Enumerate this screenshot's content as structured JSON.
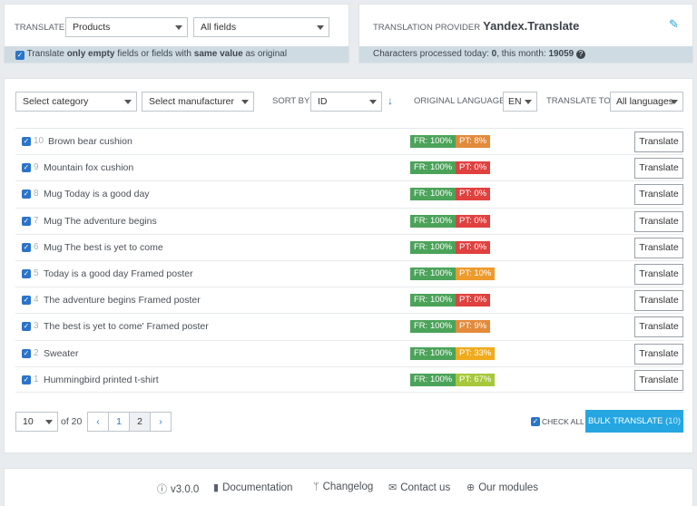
{
  "translate_bar": {
    "label": "TRANSLATE",
    "type_value": "Products",
    "fields_value": "All fields",
    "option_prefix": "Translate ",
    "option_bold1": "only empty",
    "option_mid": " fields or fields with ",
    "option_bold2": "same value",
    "option_suffix": " as original"
  },
  "provider": {
    "label": "TRANSLATION PROVIDER",
    "name": "Yandex.Translate",
    "chars_prefix": "Characters processed today: ",
    "chars_today": "0",
    "chars_mid": ", this month: ",
    "chars_month": "19059",
    "help_glyph": "?"
  },
  "filters": {
    "category": "Select category",
    "manufacturer": "Select manufacturer",
    "sort_label": "SORT BY",
    "sort_value": "ID",
    "sort_icon": "sort-desc-arrow",
    "orig_lang_label": "ORIGINAL LANGUAGE",
    "orig_lang_value": "EN",
    "translate_to_label": "TRANSLATE TO",
    "translate_to_value": "All languages"
  },
  "products": [
    {
      "id": "10",
      "name": "Brown bear cushion",
      "fr": "FR: 100%",
      "pt": "PT: 8%",
      "pt_color": "#e38a3b"
    },
    {
      "id": "9",
      "name": "Mountain fox cushion",
      "fr": "FR: 100%",
      "pt": "PT: 0%",
      "pt_color": "#e0413f"
    },
    {
      "id": "8",
      "name": "Mug Today is a good day",
      "fr": "FR: 100%",
      "pt": "PT: 0%",
      "pt_color": "#e0413f"
    },
    {
      "id": "7",
      "name": "Mug The adventure begins",
      "fr": "FR: 100%",
      "pt": "PT: 0%",
      "pt_color": "#e0413f"
    },
    {
      "id": "6",
      "name": "Mug The best is yet to come",
      "fr": "FR: 100%",
      "pt": "PT: 0%",
      "pt_color": "#e0413f"
    },
    {
      "id": "5",
      "name": "Today is a good day Framed poster",
      "fr": "FR: 100%",
      "pt": "PT: 10%",
      "pt_color": "#ee9a2c"
    },
    {
      "id": "4",
      "name": "The adventure begins Framed poster",
      "fr": "FR: 100%",
      "pt": "PT: 0%",
      "pt_color": "#e0413f"
    },
    {
      "id": "3",
      "name": "The best is yet to come' Framed poster",
      "fr": "FR: 100%",
      "pt": "PT: 9%",
      "pt_color": "#e38a3b"
    },
    {
      "id": "2",
      "name": "Sweater",
      "fr": "FR: 100%",
      "pt": "PT: 33%",
      "pt_color": "#f0ab1c"
    },
    {
      "id": "1",
      "name": "Hummingbird printed t-shirt",
      "fr": "FR: 100%",
      "pt": "PT: 67%",
      "pt_color": "#a6c83a"
    }
  ],
  "fr_color": "#4ba35a",
  "translate_label": "Translate",
  "pagination": {
    "per_page": "10",
    "of_total": "of 20",
    "prev_icon": "chevron-left",
    "pages": [
      "1",
      "2"
    ],
    "current_page": "2",
    "next_icon": "chevron-right"
  },
  "check_all_label": "CHECK ALL",
  "bulk_label": "BULK TRANSLATE",
  "bulk_count": "(10)",
  "accent_color": "#25a6e1",
  "footer": {
    "version": "v3.0.0",
    "documentation": "Documentation",
    "changelog": "Changelog",
    "contact": "Contact us",
    "modules": "Our modules"
  }
}
